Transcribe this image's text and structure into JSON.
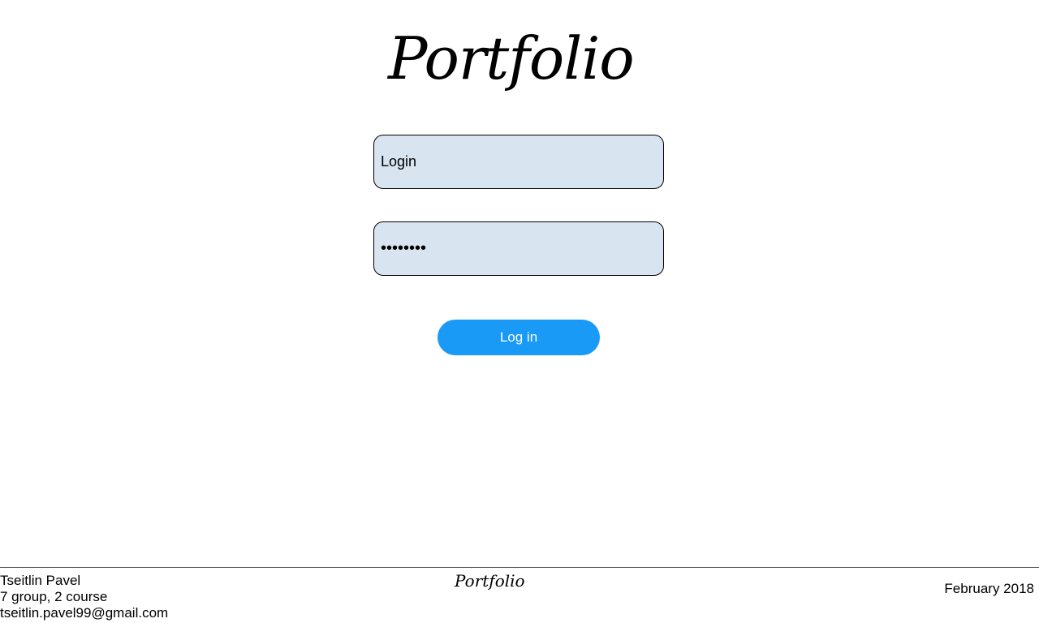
{
  "header": {
    "title": "Portfolio"
  },
  "form": {
    "login_placeholder": "Login",
    "password_value": "••••••••",
    "submit_label": "Log in"
  },
  "footer": {
    "author_name": "Tseitlin Pavel",
    "author_group": "7 group, 2 course",
    "author_email": "tseitlin.pavel99@gmail.com",
    "center_title": "Portfolio",
    "date": "February 2018"
  },
  "colors": {
    "field_background": "#d8e4f0",
    "button_background": "#1a9af7",
    "button_text": "#ffffff"
  }
}
